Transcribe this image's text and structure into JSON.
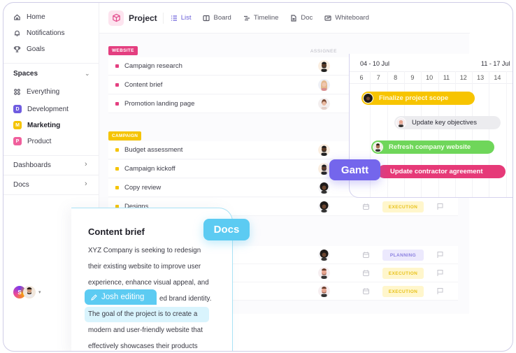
{
  "sidebar": {
    "nav": [
      {
        "label": "Home",
        "icon": "home-icon"
      },
      {
        "label": "Notifications",
        "icon": "bell-icon"
      },
      {
        "label": "Goals",
        "icon": "trophy-icon"
      }
    ],
    "spaces_heading": "Spaces",
    "everything_label": "Everything",
    "spaces": [
      {
        "label": "Development",
        "initial": "D",
        "color": "#6f5ce0"
      },
      {
        "label": "Marketing",
        "initial": "M",
        "color": "#f5c400"
      },
      {
        "label": "Product",
        "initial": "P",
        "color": "#f05f9c"
      }
    ],
    "dashboards_label": "Dashboards",
    "docs_label": "Docs",
    "user_initial": "S"
  },
  "header": {
    "project_title": "Project",
    "tabs": [
      {
        "label": "List",
        "icon": "list-icon",
        "active": true
      },
      {
        "label": "Board",
        "icon": "board-icon"
      },
      {
        "label": "Timeline",
        "icon": "timeline-icon"
      },
      {
        "label": "Doc",
        "icon": "doc-icon"
      },
      {
        "label": "Whiteboard",
        "icon": "whiteboard-icon"
      }
    ]
  },
  "list": {
    "assignee_header": "ASSIGNEE",
    "groups": [
      {
        "label": "WEBSITE",
        "color": "#e43f80",
        "tasks": [
          "Campaign research",
          "Content brief",
          "Promotion landing page"
        ]
      },
      {
        "label": "CAMPAIGN",
        "color": "#f5c400",
        "tasks": [
          "Budget assessment",
          "Campaign kickoff",
          "Copy review",
          "Designs"
        ]
      }
    ],
    "status_rows": [
      {
        "status": "EXECUTION"
      },
      {
        "status": "PLANNING"
      },
      {
        "status": "EXECUTION"
      },
      {
        "status": "EXECUTION"
      }
    ],
    "status_colors": {
      "EXECUTION": {
        "bg": "#fff6cc",
        "fg": "#e8c21a"
      },
      "PLANNING": {
        "bg": "#ece9fd",
        "fg": "#8a7fe0"
      }
    }
  },
  "gantt": {
    "weeks": [
      "04 - 10 Jul",
      "11 - 17 Jul"
    ],
    "days": [
      "6",
      "7",
      "8",
      "9",
      "10",
      "11",
      "12",
      "13",
      "14"
    ],
    "bars": [
      {
        "label": "Finalize project scope",
        "color": "#f7c400",
        "text_color": "#fff8d9"
      },
      {
        "label": "Update key objectives",
        "color": "#ececef",
        "text_color": "#2b2b35"
      },
      {
        "label": "Refresh company website",
        "color": "#6fd65a",
        "text_color": "#f2ffe9"
      },
      {
        "label": "Update contractor agreement",
        "color": "#e63a78",
        "text_color": "#ffffff"
      }
    ],
    "badge": "Gantt",
    "badge_color": "#7466ec"
  },
  "doc": {
    "badge": "Docs",
    "badge_color": "#5ccbf2",
    "title": "Content brief",
    "lines": [
      "XYZ Company is seeking to redesign",
      "their existing website to improve user",
      "experience, enhance visual appeal, and",
      "ed brand identity.",
      "The goal of the project is to create a",
      "modern and user-friendly website that",
      "effectively showcases their products"
    ],
    "editing_label": "Josh editing"
  }
}
